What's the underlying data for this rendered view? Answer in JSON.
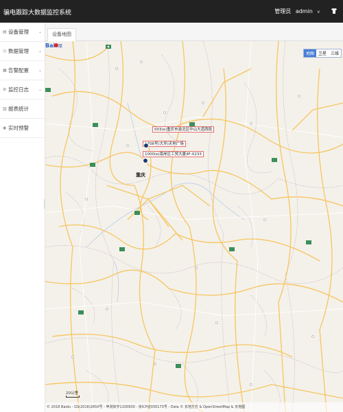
{
  "app": {
    "title": "骗电跟踪大数据监控系统"
  },
  "user": {
    "role": "管理员",
    "name": "admin",
    "caret": "v"
  },
  "sidebar": {
    "items": [
      {
        "label": "设备管理",
        "has_chevron": true
      },
      {
        "label": "数据管理",
        "has_chevron": true
      },
      {
        "label": "告警配置",
        "has_chevron": true
      },
      {
        "label": "监控日志",
        "has_chevron": true
      },
      {
        "label": "报表统计",
        "has_chevron": false
      },
      {
        "label": "实时预警",
        "has_chevron": false
      }
    ]
  },
  "tabs": [
    {
      "label": "设备地图"
    }
  ],
  "map": {
    "type_toggle": {
      "map": "地图",
      "satellite": "卫星",
      "3d": "三维"
    },
    "city_label": "重庆",
    "callouts": [
      "003(e)重庆市渝北区中山大道西段",
      "1706号(大坪)天地广场",
      "1000(e)南岸区工贸大厦4F-0233"
    ],
    "scale_label": "20公里",
    "copyright": "© 2018 Baidu - GS(2016)2650号 - 甲测资字1100930 - 京ICP证030173号 - Data © 长地万方 & OpenStreetMap & 天地图"
  },
  "colors": {
    "topbar": "#222222",
    "map_bg": "#f4f1ea",
    "road_major": "#f7c560",
    "road_minor": "#ffffff",
    "boundary": "#c4b2c6",
    "accent": "#4a7fd6"
  }
}
